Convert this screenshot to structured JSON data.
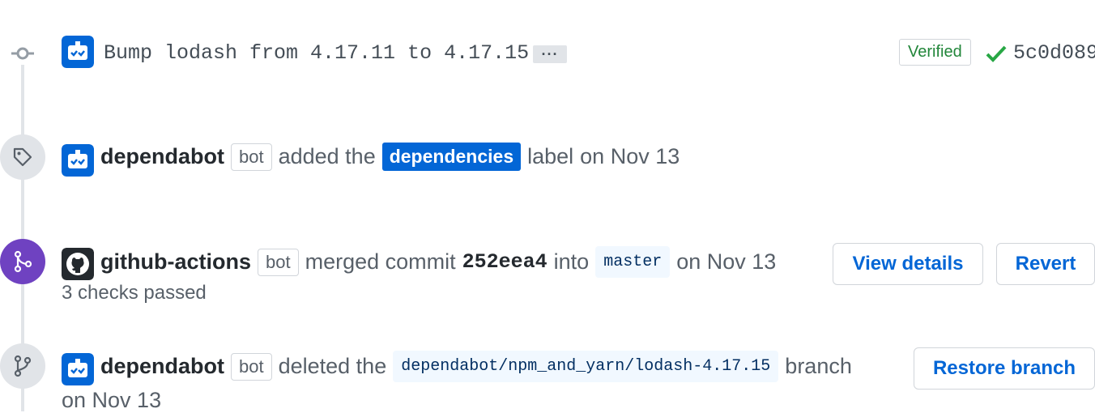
{
  "commit": {
    "message": "Bump lodash from 4.17.11 to 4.17.15",
    "expand_label": "···",
    "verified_label": "Verified",
    "sha": "5c0d089",
    "avatar_icon": "dependabot-avatar"
  },
  "label_event": {
    "actor": "dependabot",
    "bot_tag": "bot",
    "action": "added the",
    "label_name": "dependencies",
    "suffix": "label",
    "date": "on Nov 13",
    "icon": "tag-icon",
    "label_color": "#0366d6"
  },
  "merge_event": {
    "actor": "github-actions",
    "bot_tag": "bot",
    "action": "merged commit",
    "commit_sha": "252eea4",
    "into": "into",
    "branch": "master",
    "date": "on Nov 13",
    "checks": "3 checks passed",
    "view_details_label": "View details",
    "revert_label": "Revert",
    "icon": "merge-icon",
    "icon_color": "#6f42c1"
  },
  "delete_event": {
    "actor": "dependabot",
    "bot_tag": "bot",
    "action": "deleted the",
    "branch": "dependabot/npm_and_yarn/lodash-4.17.15",
    "suffix": "branch",
    "date": "on Nov 13",
    "restore_label": "Restore branch",
    "icon": "branch-icon"
  }
}
